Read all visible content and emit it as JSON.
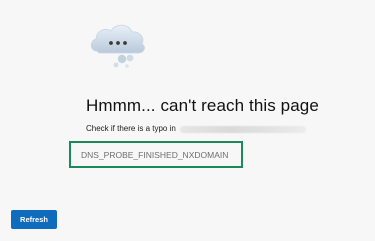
{
  "error": {
    "title": "Hmmm... can't reach this page",
    "hint": "Check if there is a typo in",
    "code": "DNS_PROBE_FINISHED_NXDOMAIN",
    "icon": "cloud-thinking-icon"
  },
  "actions": {
    "refresh_label": "Refresh"
  },
  "colors": {
    "background": "#f7f7f7",
    "highlight_border": "#1a8a5a",
    "button": "#0f6cbd",
    "button_text": "#ffffff",
    "code_text": "#6e6e6e"
  }
}
